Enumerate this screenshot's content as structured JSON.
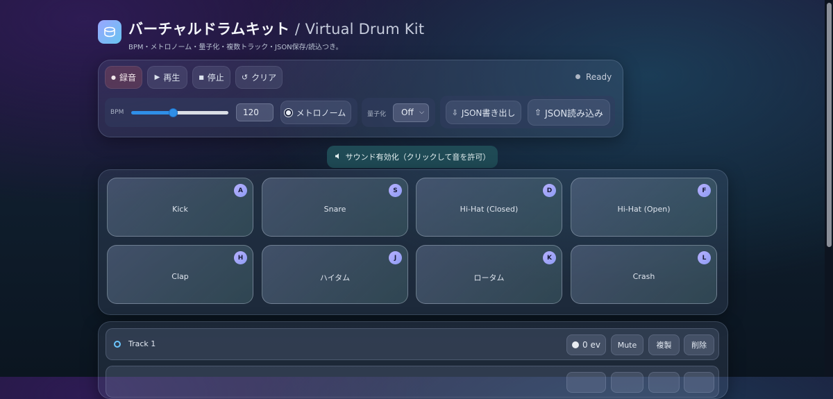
{
  "header": {
    "title_ja": "バーチャルドラムキット",
    "title_sep": "/",
    "title_en": "Virtual Drum Kit",
    "subtitle": "BPM・メトロノーム・量子化・複数トラック・JSON保存/読込つき。",
    "logo_icon": "drum-icon"
  },
  "controls": {
    "record": "録音",
    "play": "再生",
    "stop": "停止",
    "clear": "クリア",
    "status": "Ready",
    "bpm_label": "BPM",
    "bpm_value": "120",
    "bpm_slider_fraction": 0.43,
    "metronome": "メトロノーム",
    "quantize_label": "量子化",
    "quantize_value": "Off",
    "export_json": "JSON書き出し",
    "import_json": "JSON読み込み"
  },
  "sound_enable": "サウンド有効化（クリックして音を許可）",
  "pads": [
    {
      "name": "Kick",
      "key": "A"
    },
    {
      "name": "Snare",
      "key": "S"
    },
    {
      "name": "Hi-Hat (Closed)",
      "key": "D"
    },
    {
      "name": "Hi-Hat (Open)",
      "key": "F"
    },
    {
      "name": "Clap",
      "key": "H"
    },
    {
      "name": "ハイタム",
      "key": "J"
    },
    {
      "name": "ロータム",
      "key": "K"
    },
    {
      "name": "Crash",
      "key": "L"
    }
  ],
  "tracks": [
    {
      "name": "Track 1",
      "events": "0 ev",
      "mute": "Mute",
      "duplicate": "複製",
      "delete": "削除"
    }
  ],
  "colors": {
    "accent": "#2f8ee8",
    "pad_key": "#9aa6ff",
    "sound_button": "#1f4a55",
    "track_ring": "#6cc7ff"
  }
}
